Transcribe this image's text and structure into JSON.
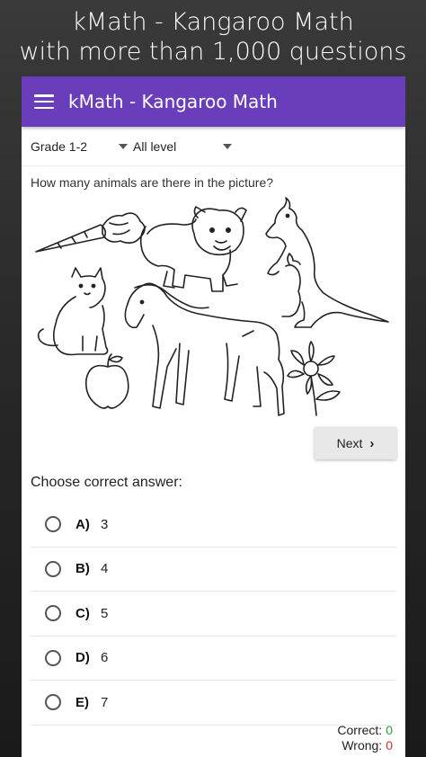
{
  "promo": {
    "line1": "kMath - Kangaroo Math",
    "line2": "with more than 1,000 questions"
  },
  "appbar": {
    "title": "kMath - Kangaroo Math",
    "color": "#6a3dbb"
  },
  "filters": {
    "grade": "Grade 1-2",
    "level": "All level"
  },
  "question": {
    "text": "How many animals are there in the picture?",
    "picture_items": [
      "carrot",
      "bulldog",
      "kangaroo",
      "cat",
      "horse",
      "apple",
      "flower"
    ]
  },
  "next_button": {
    "label": "Next"
  },
  "answers": {
    "prompt": "Choose correct answer:",
    "options": [
      {
        "letter": "A)",
        "value": "3"
      },
      {
        "letter": "B)",
        "value": "4"
      },
      {
        "letter": "C)",
        "value": "5"
      },
      {
        "letter": "D)",
        "value": "6"
      },
      {
        "letter": "E)",
        "value": "7"
      }
    ]
  },
  "score": {
    "correct_label": "Correct:",
    "correct_value": "0",
    "wrong_label": "Wrong:",
    "wrong_value": "0",
    "correct_color": "#2e9a3a",
    "wrong_color": "#d32f2f"
  }
}
